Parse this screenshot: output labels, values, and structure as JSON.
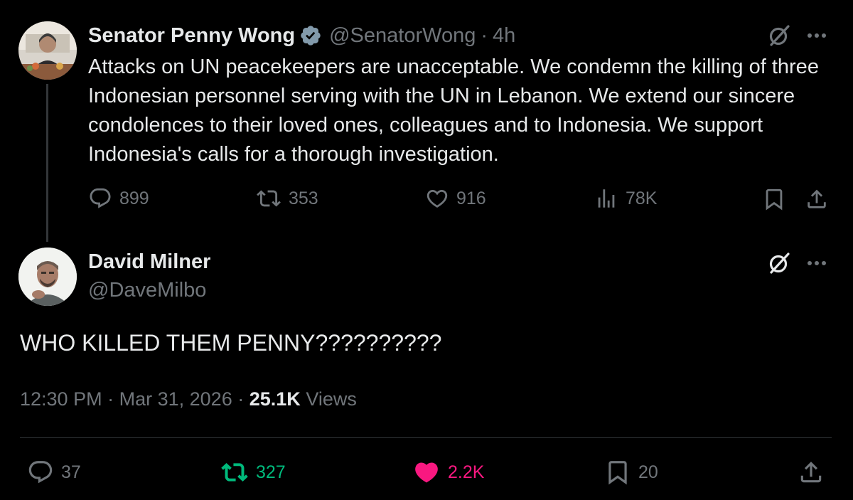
{
  "original_tweet": {
    "author_name": "Senator Penny Wong",
    "handle": "@SenatorWong",
    "separator": "·",
    "time_ago": "4h",
    "text": "Attacks on UN peacekeepers are unacceptable. We condemn the killing of three Indonesian personnel serving with the UN in Lebanon. We extend our sincere condolences to their loved ones, colleagues and to Indonesia. We support Indonesia's calls for a thorough investigation.",
    "verified": true,
    "actions": {
      "replies": "899",
      "reposts": "353",
      "likes": "916",
      "views": "78K"
    }
  },
  "reply_tweet": {
    "author_name": "David Milner",
    "handle": "@DaveMilbo",
    "text": "WHO KILLED THEM PENNY??????????",
    "time": "12:30 PM",
    "sep1": "·",
    "date": "Mar 31, 2026",
    "sep2": "·",
    "views_count": "25.1K",
    "views_label": "Views",
    "actions": {
      "replies": "37",
      "reposts": "327",
      "likes": "2.2K",
      "bookmarks": "20"
    }
  },
  "colors": {
    "background": "#000000",
    "text_primary": "#e7e9ea",
    "text_secondary": "#71767b",
    "verified_badge": "#829aab",
    "repost_active": "#00ba7c",
    "like_active": "#f91880",
    "divider": "#2f3336"
  },
  "icons": [
    "grok-icon",
    "more-icon",
    "verified-badge-icon",
    "reply-icon",
    "repost-icon",
    "like-icon",
    "views-icon",
    "bookmark-icon",
    "share-icon"
  ]
}
